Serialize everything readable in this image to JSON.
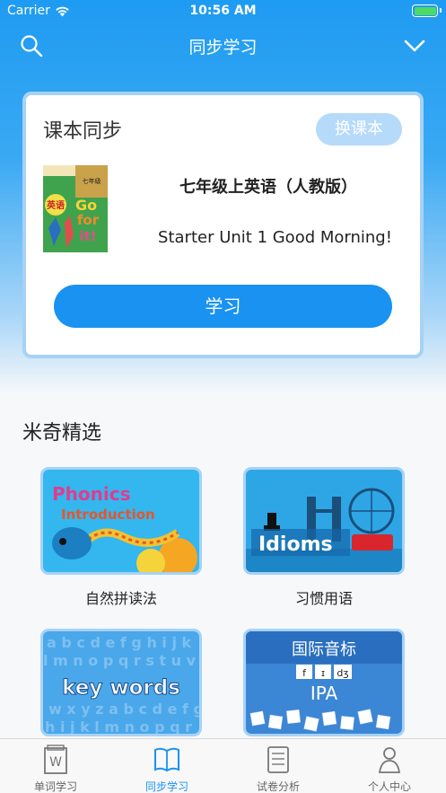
{
  "status_bar": {
    "carrier": "Carrier",
    "time": "10:56 AM"
  },
  "nav": {
    "title": "同步学习"
  },
  "book_card": {
    "title": "课本同步",
    "change_button": "换课本",
    "book_name": "七年级上英语（人教版）",
    "unit": "Starter Unit 1 Good Morning!",
    "study_button": "学习",
    "cover": {
      "label_cn": "英语",
      "label_go": "Go",
      "label_for": "for",
      "label_it": "it!",
      "label_grade": "七年级"
    }
  },
  "featured": {
    "title": "米奇精选",
    "items": [
      {
        "label": "自然拼读法",
        "art_lines": [
          "Phonics",
          "Introduction"
        ]
      },
      {
        "label": "习惯用语",
        "art_lines": [
          "Idioms"
        ]
      },
      {
        "label": "",
        "art_lines": [
          "key words"
        ]
      },
      {
        "label": "",
        "art_lines": [
          "国际音标",
          "IPA"
        ],
        "chips": [
          "f",
          "ɪ",
          "dʒ"
        ]
      }
    ]
  },
  "tabs": [
    {
      "label": "单词学习",
      "icon": "word-book-icon",
      "active": false
    },
    {
      "label": "同步学习",
      "icon": "open-book-icon",
      "active": true
    },
    {
      "label": "试卷分析",
      "icon": "scroll-paper-icon",
      "active": false
    },
    {
      "label": "个人中心",
      "icon": "person-icon",
      "active": false
    }
  ],
  "colors": {
    "primary": "#1992f1",
    "accent_light": "#b5dafa",
    "card_border": "#a6d2f6"
  }
}
